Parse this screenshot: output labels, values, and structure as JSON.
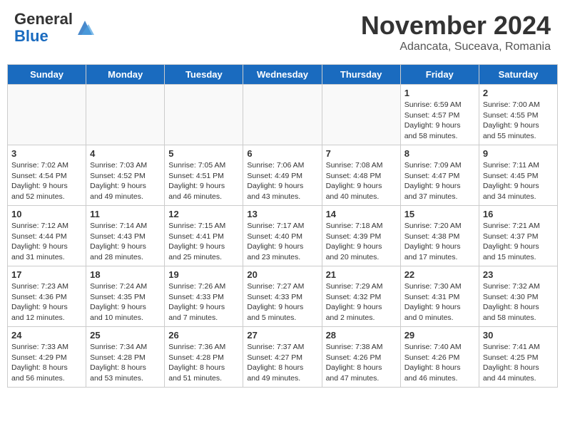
{
  "header": {
    "logo_general": "General",
    "logo_blue": "Blue",
    "month_title": "November 2024",
    "location": "Adancata, Suceava, Romania"
  },
  "days_of_week": [
    "Sunday",
    "Monday",
    "Tuesday",
    "Wednesday",
    "Thursday",
    "Friday",
    "Saturday"
  ],
  "weeks": [
    [
      {
        "day": "",
        "info": ""
      },
      {
        "day": "",
        "info": ""
      },
      {
        "day": "",
        "info": ""
      },
      {
        "day": "",
        "info": ""
      },
      {
        "day": "",
        "info": ""
      },
      {
        "day": "1",
        "info": "Sunrise: 6:59 AM\nSunset: 4:57 PM\nDaylight: 9 hours and 58 minutes."
      },
      {
        "day": "2",
        "info": "Sunrise: 7:00 AM\nSunset: 4:55 PM\nDaylight: 9 hours and 55 minutes."
      }
    ],
    [
      {
        "day": "3",
        "info": "Sunrise: 7:02 AM\nSunset: 4:54 PM\nDaylight: 9 hours and 52 minutes."
      },
      {
        "day": "4",
        "info": "Sunrise: 7:03 AM\nSunset: 4:52 PM\nDaylight: 9 hours and 49 minutes."
      },
      {
        "day": "5",
        "info": "Sunrise: 7:05 AM\nSunset: 4:51 PM\nDaylight: 9 hours and 46 minutes."
      },
      {
        "day": "6",
        "info": "Sunrise: 7:06 AM\nSunset: 4:49 PM\nDaylight: 9 hours and 43 minutes."
      },
      {
        "day": "7",
        "info": "Sunrise: 7:08 AM\nSunset: 4:48 PM\nDaylight: 9 hours and 40 minutes."
      },
      {
        "day": "8",
        "info": "Sunrise: 7:09 AM\nSunset: 4:47 PM\nDaylight: 9 hours and 37 minutes."
      },
      {
        "day": "9",
        "info": "Sunrise: 7:11 AM\nSunset: 4:45 PM\nDaylight: 9 hours and 34 minutes."
      }
    ],
    [
      {
        "day": "10",
        "info": "Sunrise: 7:12 AM\nSunset: 4:44 PM\nDaylight: 9 hours and 31 minutes."
      },
      {
        "day": "11",
        "info": "Sunrise: 7:14 AM\nSunset: 4:43 PM\nDaylight: 9 hours and 28 minutes."
      },
      {
        "day": "12",
        "info": "Sunrise: 7:15 AM\nSunset: 4:41 PM\nDaylight: 9 hours and 25 minutes."
      },
      {
        "day": "13",
        "info": "Sunrise: 7:17 AM\nSunset: 4:40 PM\nDaylight: 9 hours and 23 minutes."
      },
      {
        "day": "14",
        "info": "Sunrise: 7:18 AM\nSunset: 4:39 PM\nDaylight: 9 hours and 20 minutes."
      },
      {
        "day": "15",
        "info": "Sunrise: 7:20 AM\nSunset: 4:38 PM\nDaylight: 9 hours and 17 minutes."
      },
      {
        "day": "16",
        "info": "Sunrise: 7:21 AM\nSunset: 4:37 PM\nDaylight: 9 hours and 15 minutes."
      }
    ],
    [
      {
        "day": "17",
        "info": "Sunrise: 7:23 AM\nSunset: 4:36 PM\nDaylight: 9 hours and 12 minutes."
      },
      {
        "day": "18",
        "info": "Sunrise: 7:24 AM\nSunset: 4:35 PM\nDaylight: 9 hours and 10 minutes."
      },
      {
        "day": "19",
        "info": "Sunrise: 7:26 AM\nSunset: 4:33 PM\nDaylight: 9 hours and 7 minutes."
      },
      {
        "day": "20",
        "info": "Sunrise: 7:27 AM\nSunset: 4:33 PM\nDaylight: 9 hours and 5 minutes."
      },
      {
        "day": "21",
        "info": "Sunrise: 7:29 AM\nSunset: 4:32 PM\nDaylight: 9 hours and 2 minutes."
      },
      {
        "day": "22",
        "info": "Sunrise: 7:30 AM\nSunset: 4:31 PM\nDaylight: 9 hours and 0 minutes."
      },
      {
        "day": "23",
        "info": "Sunrise: 7:32 AM\nSunset: 4:30 PM\nDaylight: 8 hours and 58 minutes."
      }
    ],
    [
      {
        "day": "24",
        "info": "Sunrise: 7:33 AM\nSunset: 4:29 PM\nDaylight: 8 hours and 56 minutes."
      },
      {
        "day": "25",
        "info": "Sunrise: 7:34 AM\nSunset: 4:28 PM\nDaylight: 8 hours and 53 minutes."
      },
      {
        "day": "26",
        "info": "Sunrise: 7:36 AM\nSunset: 4:28 PM\nDaylight: 8 hours and 51 minutes."
      },
      {
        "day": "27",
        "info": "Sunrise: 7:37 AM\nSunset: 4:27 PM\nDaylight: 8 hours and 49 minutes."
      },
      {
        "day": "28",
        "info": "Sunrise: 7:38 AM\nSunset: 4:26 PM\nDaylight: 8 hours and 47 minutes."
      },
      {
        "day": "29",
        "info": "Sunrise: 7:40 AM\nSunset: 4:26 PM\nDaylight: 8 hours and 46 minutes."
      },
      {
        "day": "30",
        "info": "Sunrise: 7:41 AM\nSunset: 4:25 PM\nDaylight: 8 hours and 44 minutes."
      }
    ]
  ]
}
